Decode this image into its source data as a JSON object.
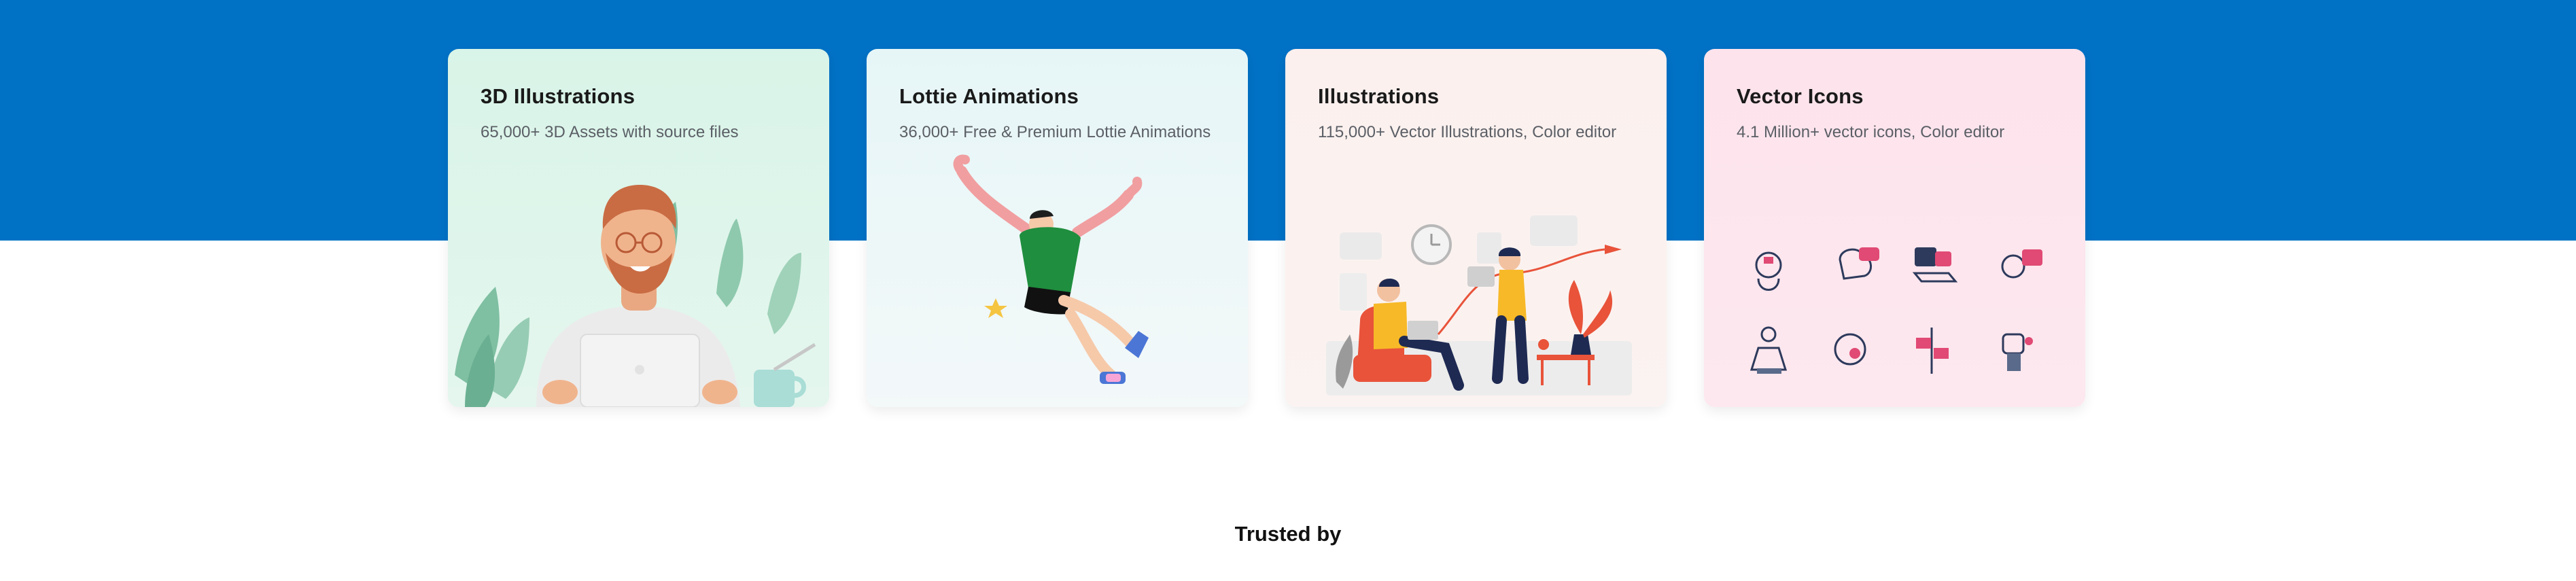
{
  "cards": [
    {
      "title": "3D Illustrations",
      "description": "65,000+ 3D Assets with source files"
    },
    {
      "title": "Lottie Animations",
      "description": "36,000+ Free & Premium Lottie Animations"
    },
    {
      "title": "Illustrations",
      "description": "115,000+ Vector Illustrations, Color editor"
    },
    {
      "title": "Vector Icons",
      "description": "4.1 Million+ vector icons, Color editor"
    }
  ],
  "footer": {
    "trusted_label": "Trusted by"
  },
  "colors": {
    "band": "#0072c6",
    "title": "#1a1a1a",
    "desc": "#5b5f66"
  }
}
